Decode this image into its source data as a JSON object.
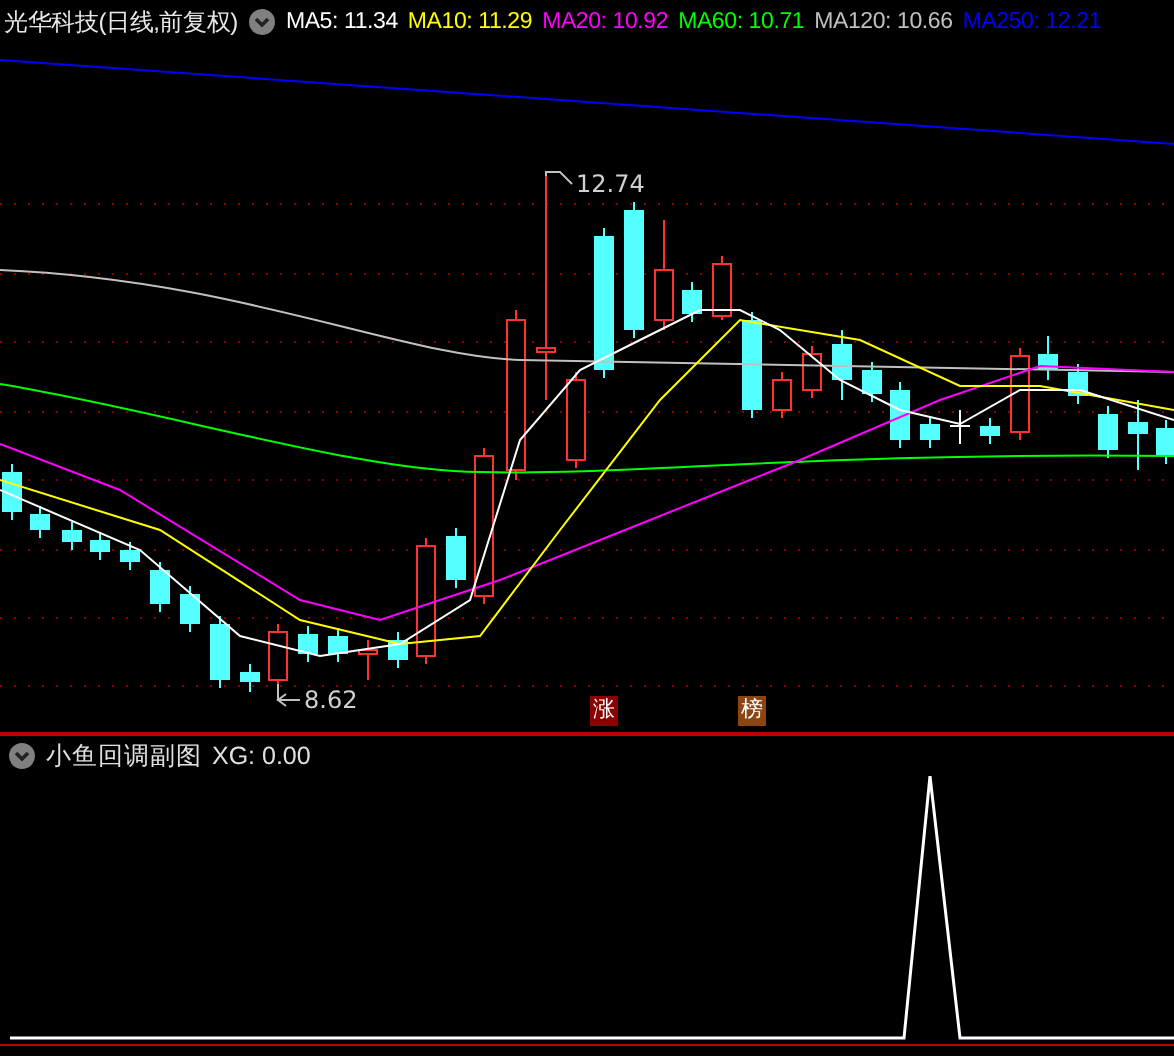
{
  "header": {
    "title": "光华科技(日线,前复权)",
    "indicators": [
      {
        "label": "MA5: 11.34",
        "color": "#ffffff"
      },
      {
        "label": "MA10: 11.29",
        "color": "#ffff00"
      },
      {
        "label": "MA20: 10.92",
        "color": "#ff00ff"
      },
      {
        "label": "MA60: 10.71",
        "color": "#00ff00"
      },
      {
        "label": "MA120: 10.66",
        "color": "#c0c0c0"
      },
      {
        "label": "MA250: 12.21",
        "color": "#0000ff"
      }
    ]
  },
  "main_chart": {
    "high_label": "12.74",
    "low_label": "8.62",
    "badges": [
      {
        "text": "涨",
        "color": "#8b0000"
      },
      {
        "text": "榜",
        "color": "#8b4513"
      }
    ]
  },
  "sub_chart": {
    "title": "小鱼回调副图",
    "reading": "XG: 0.00"
  }
}
